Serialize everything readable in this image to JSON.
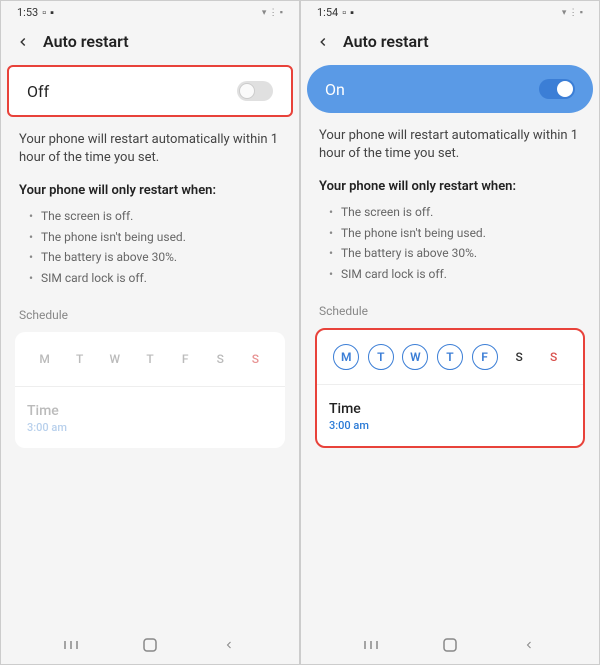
{
  "left": {
    "time": "1:53",
    "title": "Auto restart",
    "toggle_label": "Off",
    "toggle_state": "off",
    "desc": "Your phone will restart automatically within 1 hour of the time you set.",
    "subhead": "Your phone will only restart when:",
    "conditions": [
      "The screen is off.",
      "The phone isn't being used.",
      "The battery is above 30%.",
      "SIM card lock is off."
    ],
    "schedule_label": "Schedule",
    "days": [
      "M",
      "T",
      "W",
      "T",
      "F",
      "S",
      "S"
    ],
    "time_label": "Time",
    "time_value": "3:00 am"
  },
  "right": {
    "time": "1:54",
    "title": "Auto restart",
    "toggle_label": "On",
    "toggle_state": "on",
    "desc": "Your phone will restart automatically within 1 hour of the time you set.",
    "subhead": "Your phone will only restart when:",
    "conditions": [
      "The screen is off.",
      "The phone isn't being used.",
      "The battery is above 30%.",
      "SIM card lock is off."
    ],
    "schedule_label": "Schedule",
    "days": [
      {
        "label": "M",
        "selected": true
      },
      {
        "label": "T",
        "selected": true
      },
      {
        "label": "W",
        "selected": true
      },
      {
        "label": "T",
        "selected": true
      },
      {
        "label": "F",
        "selected": true
      },
      {
        "label": "S",
        "selected": false,
        "type": "sat"
      },
      {
        "label": "S",
        "selected": false,
        "type": "sun"
      }
    ],
    "time_label": "Time",
    "time_value": "3:00 am"
  }
}
